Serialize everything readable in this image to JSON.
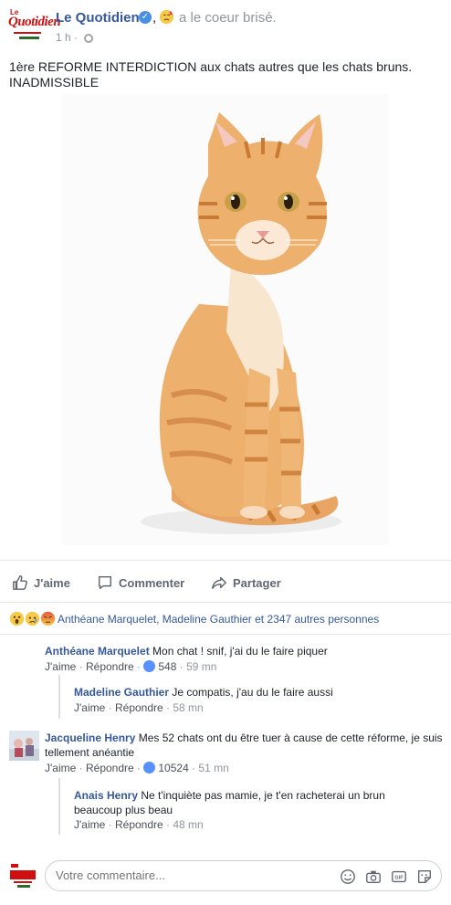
{
  "post": {
    "page_name": "Le Quotidien",
    "feeling_separator": ",",
    "feeling_text": "a le coeur brisé.",
    "time": "1 h",
    "dot": "·",
    "text": "1ère REFORME INTERDICTION aux chats autres que les chats bruns. INADMISSIBLE",
    "logo_line1": "Le",
    "logo_line2": "Quotidien"
  },
  "actions": {
    "like": "J'aime",
    "comment": "Commenter",
    "share": "Partager"
  },
  "reactions": {
    "summary": "Anthéane Marquelet, Madeline Gauthier et 2347 autres personnes",
    "icons": [
      "wow-icon",
      "sad-icon",
      "angry-icon"
    ]
  },
  "comments": [
    {
      "author": "Anthéane Marquelet",
      "text": "Mon chat ! snif, j'ai du le faire piquer",
      "like": "J'aime",
      "reply": "Répondre",
      "likes_count": "548",
      "time": "59 mn"
    },
    {
      "author": "Madeline Gauthier",
      "text": "Je compatis, j'au du le faire aussi",
      "like": "J'aime",
      "reply": "Répondre",
      "time": "58 mn"
    },
    {
      "author": "Jacqueline Henry",
      "text": "Mes 52 chats ont du être tuer à cause de cette réforme, je suis tellement anéantie",
      "like": "J'aime",
      "reply": "Répondre",
      "likes_count": "10524",
      "time": "51 mn"
    },
    {
      "author": "Anais Henry",
      "text": "Ne t'inquiète pas mamie, je t'en racheterai un brun beaucoup plus beau",
      "like": "J'aime",
      "reply": "Répondre",
      "time": "48 mn"
    }
  ],
  "composer": {
    "placeholder": "Votre commentaire..."
  },
  "colors": {
    "link_blue": "#365899",
    "meta_gray": "#90949c",
    "like_blue": "#5890ff"
  }
}
